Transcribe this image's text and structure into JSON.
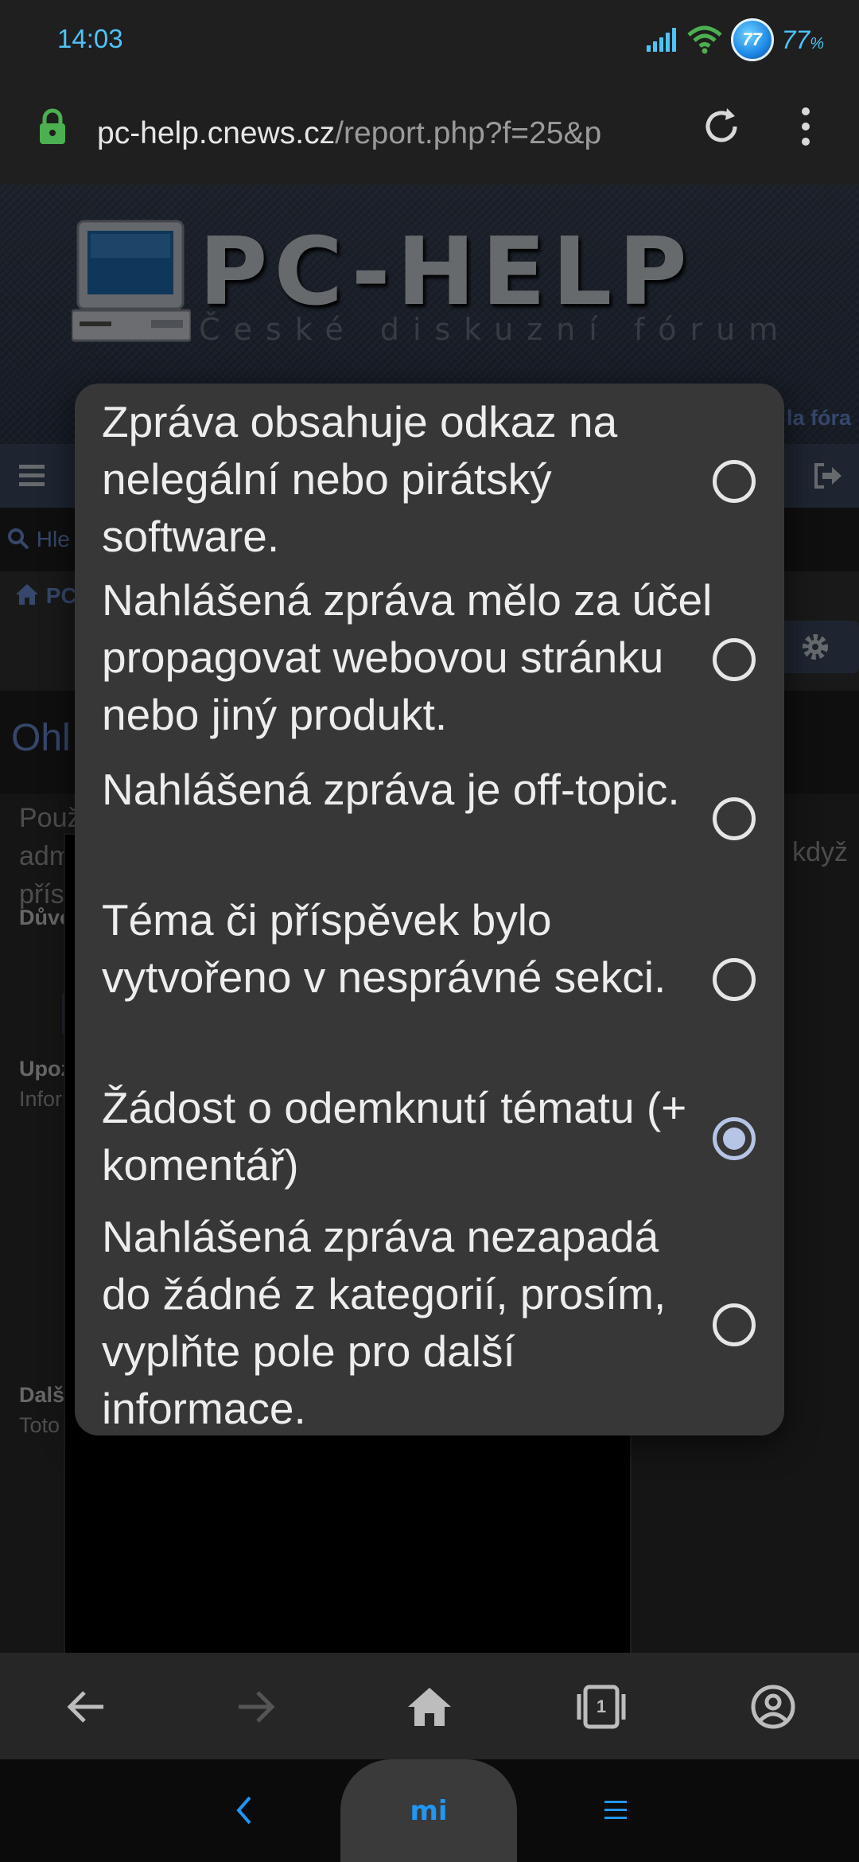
{
  "status": {
    "time": "14:03",
    "battery_badge": "77",
    "battery_pct": "77",
    "battery_unit": "%"
  },
  "browser": {
    "url_host": "pc-help.cnews.cz",
    "url_path": "/report.php?f=25&p"
  },
  "site": {
    "logo_title": "PC-HELP",
    "logo_subtitle": "České diskuzní fórum",
    "index_link": "la fóra",
    "search_link": "Hle",
    "crumb": "PC",
    "page_title": "Ohl",
    "intro_lines": [
      "Použ",
      "adm",
      "přísp"
    ],
    "intro_tail": "když",
    "reason_label": "Důvo",
    "notify_label": "Upoz",
    "notify_sub": "Inforr",
    "more_label": "Další",
    "more_sub": "Toto"
  },
  "dialog": {
    "options": [
      {
        "label": "Zpráva obsahuje odkaz na nelegální nebo pirátský software.",
        "checked": false
      },
      {
        "label": "Nahlášená zpráva mělo za účel propagovat webovou stránku nebo jiný produkt.",
        "checked": false
      },
      {
        "label": "Nahlášená zpráva je off-topic.",
        "checked": false
      },
      {
        "label": "Téma či příspěvek bylo vytvořeno v nesprávné sekci.",
        "checked": false
      },
      {
        "label": "Žádost o odemknutí tématu (+ komentář)",
        "checked": true
      },
      {
        "label": "Nahlášená zpráva nezapadá do žádné z kategorií, prosím, vyplňte pole pro další informace.",
        "checked": false
      }
    ]
  },
  "toolbar": {
    "tab_count": "1"
  },
  "sysnav": {
    "mi_logo": "mi"
  },
  "colors": {
    "accent": "#6c8fd6",
    "status_blue": "#4fc3f7",
    "dialog_bg": "#373737",
    "radio_checked": "#b6c5e6"
  }
}
